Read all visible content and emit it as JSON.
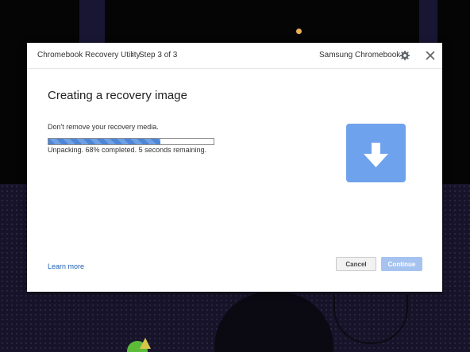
{
  "header": {
    "app_name": "Chromebook Recovery Utility",
    "separator": "›",
    "step": "Step 3 of 3",
    "device": "Samsung Chromebook",
    "settings_icon": "gear-icon",
    "close_icon": "close-icon"
  },
  "main": {
    "title": "Creating a recovery image",
    "media_message": "Don't remove your recovery media.",
    "progress_percent": 68,
    "status_text": "Unpacking. 68% completed. 5 seconds remaining.",
    "illustration_icon": "download-arrow-icon"
  },
  "footer": {
    "learn_more": "Learn more",
    "cancel_label": "Cancel",
    "continue_label": "Continue"
  },
  "colors": {
    "accent": "#6fa2ec",
    "progress": "#4d86d6",
    "link": "#1e5fb4",
    "continue_disabled": "#a6c3f0"
  }
}
